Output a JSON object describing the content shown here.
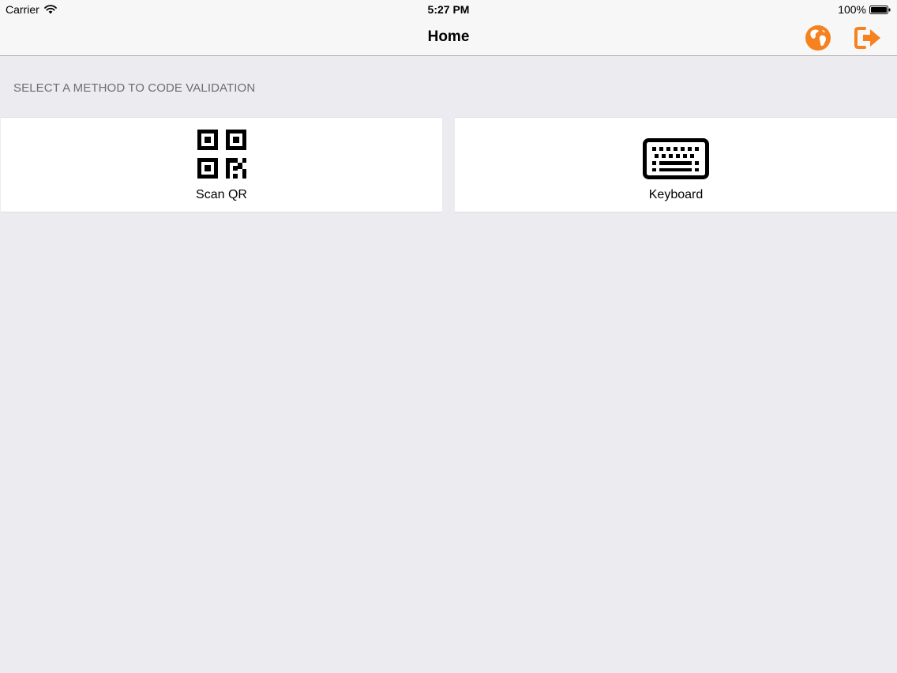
{
  "status_bar": {
    "carrier": "Carrier",
    "time": "5:27 PM",
    "battery": "100%",
    "wifi_icon": "wifi-icon",
    "battery_icon": "battery-full-icon"
  },
  "nav": {
    "title": "Home",
    "globe_icon": "globe-icon",
    "logout_icon": "logout-icon",
    "accent_color": "#f5821f"
  },
  "section": {
    "header": "SELECT A METHOD TO CODE VALIDATION"
  },
  "methods": [
    {
      "label": "Scan QR",
      "icon": "qr-code-icon"
    },
    {
      "label": "Keyboard",
      "icon": "keyboard-icon"
    }
  ]
}
